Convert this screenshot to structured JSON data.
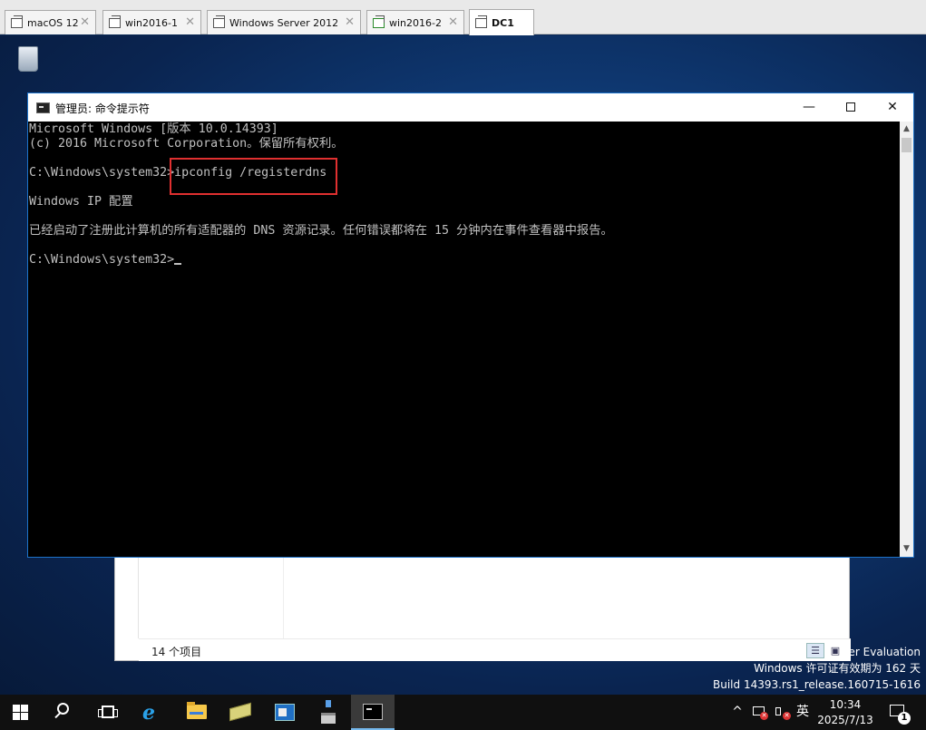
{
  "vm_tabs": [
    {
      "label": "macOS 12",
      "close": "✕",
      "active": false
    },
    {
      "label": "win2016-1",
      "close": "✕",
      "active": false
    },
    {
      "label": "Windows Server 2012",
      "close": "✕",
      "active": false
    },
    {
      "label": "win2016-2",
      "close": "✕",
      "active": false
    },
    {
      "label": "DC1",
      "close": "",
      "active": true
    }
  ],
  "cmd_window": {
    "title": "管理员: 命令提示符",
    "controls": {
      "minimize": "—",
      "close": "✕"
    },
    "lines": [
      "Microsoft Windows [版本 10.0.14393]",
      "(c) 2016 Microsoft Corporation。保留所有权利。",
      "",
      "C:\\Windows\\system32>ipconfig /registerdns",
      "",
      "Windows IP 配置",
      "",
      "已经启动了注册此计算机的所有适配器的 DNS 资源记录。任何错误都将在 15 分钟内在事件查看器中报告。",
      "",
      "C:\\Windows\\system32>"
    ],
    "scroll": {
      "up": "▲",
      "down": "▼"
    }
  },
  "explorer": {
    "item_count": "14 个项目",
    "scroll_left": "<",
    "scroll_right": ">"
  },
  "watermark": {
    "line1": "ter Evaluation",
    "line2": "Windows 许可证有效期为 162 天",
    "line3": "Build 14393.rs1_release.160715-1616"
  },
  "taskbar": {
    "icons": [
      "windows-start-icon",
      "search-icon",
      "task-view-icon",
      "internet-explorer-icon",
      "file-explorer-icon",
      "server-manager-icon",
      "control-panel-icon",
      "network-icon",
      "command-prompt-icon"
    ],
    "tray": {
      "chevron": "^",
      "ime": "英",
      "time": "10:34",
      "date": "2025/7/13",
      "notification_count": "1"
    }
  },
  "colors": {
    "console_bg": "#000000",
    "console_fg": "#c0c0c0",
    "highlight": "#e03030",
    "taskbar": "#101010",
    "active_accent": "#76b9ed"
  }
}
